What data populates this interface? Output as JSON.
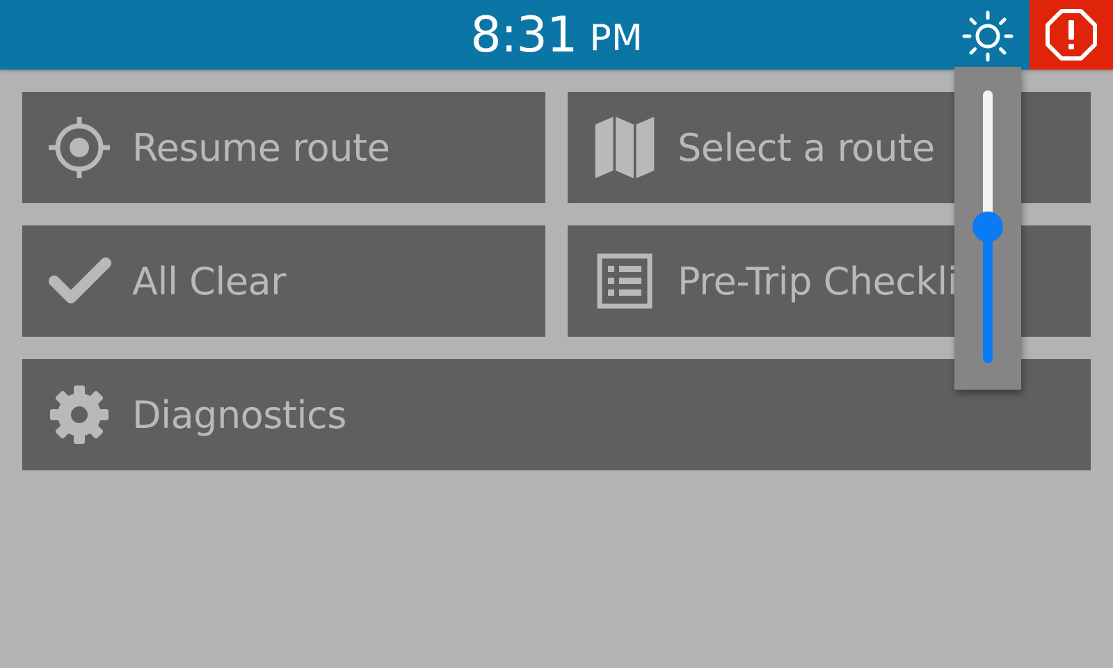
{
  "header": {
    "time": "8:31",
    "ampm": "PM",
    "brightness_icon": "sun-icon",
    "alert_icon": "alert-octagon-icon",
    "colors": {
      "header_bg": "#0b76a6",
      "alert_bg": "#e0240a"
    }
  },
  "menu": {
    "resume_route": {
      "label": "Resume route",
      "icon": "crosshair-target-icon"
    },
    "select_route": {
      "label": "Select a route",
      "icon": "map-icon"
    },
    "all_clear": {
      "label": "All Clear",
      "icon": "checkmark-icon"
    },
    "pre_trip": {
      "label": "Pre-Trip Checklist",
      "icon": "checklist-icon"
    },
    "diagnostics": {
      "label": "Diagnostics",
      "icon": "gear-icon"
    }
  },
  "brightness_slider": {
    "level": 0.5,
    "colors": {
      "fill": "#0a7af5",
      "track": "#f3f3f3"
    }
  }
}
